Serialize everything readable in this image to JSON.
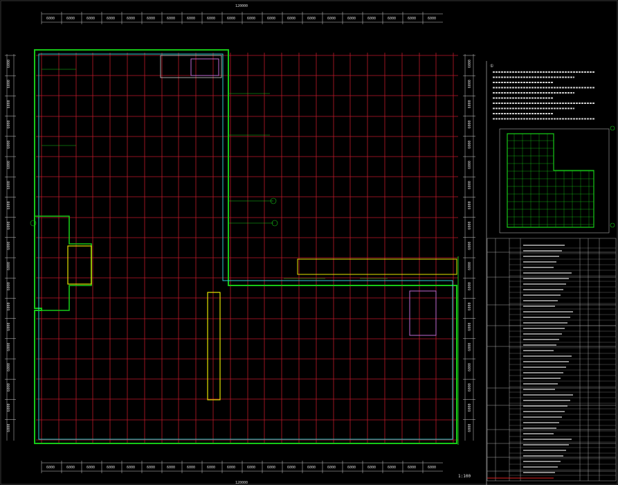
{
  "drawing": {
    "scale_label": "1:100",
    "overall_dimension": "120000",
    "notes_marker": "①",
    "grid_colors": {
      "grid": "#c0182a",
      "wall": "#17c917",
      "outline": "#2ad4d4",
      "text": "#e0e0e0",
      "dim": "#d0d0d0",
      "highlight": "#e6e600",
      "pipe": "#d22"
    },
    "top_dims": [
      "6000",
      "6000",
      "6000",
      "6000",
      "6000",
      "6000",
      "6000",
      "6000",
      "6000",
      "6000",
      "6000",
      "6000",
      "6000",
      "6000",
      "6000",
      "6000",
      "6000",
      "6000",
      "6000",
      "6000"
    ],
    "left_dims": [
      "6000",
      "6000",
      "6000",
      "6000",
      "6000",
      "6000",
      "6000",
      "6000",
      "6000",
      "6000",
      "6000",
      "6000",
      "6000",
      "6000",
      "6000",
      "6000",
      "6000",
      "6000",
      "6000"
    ]
  }
}
